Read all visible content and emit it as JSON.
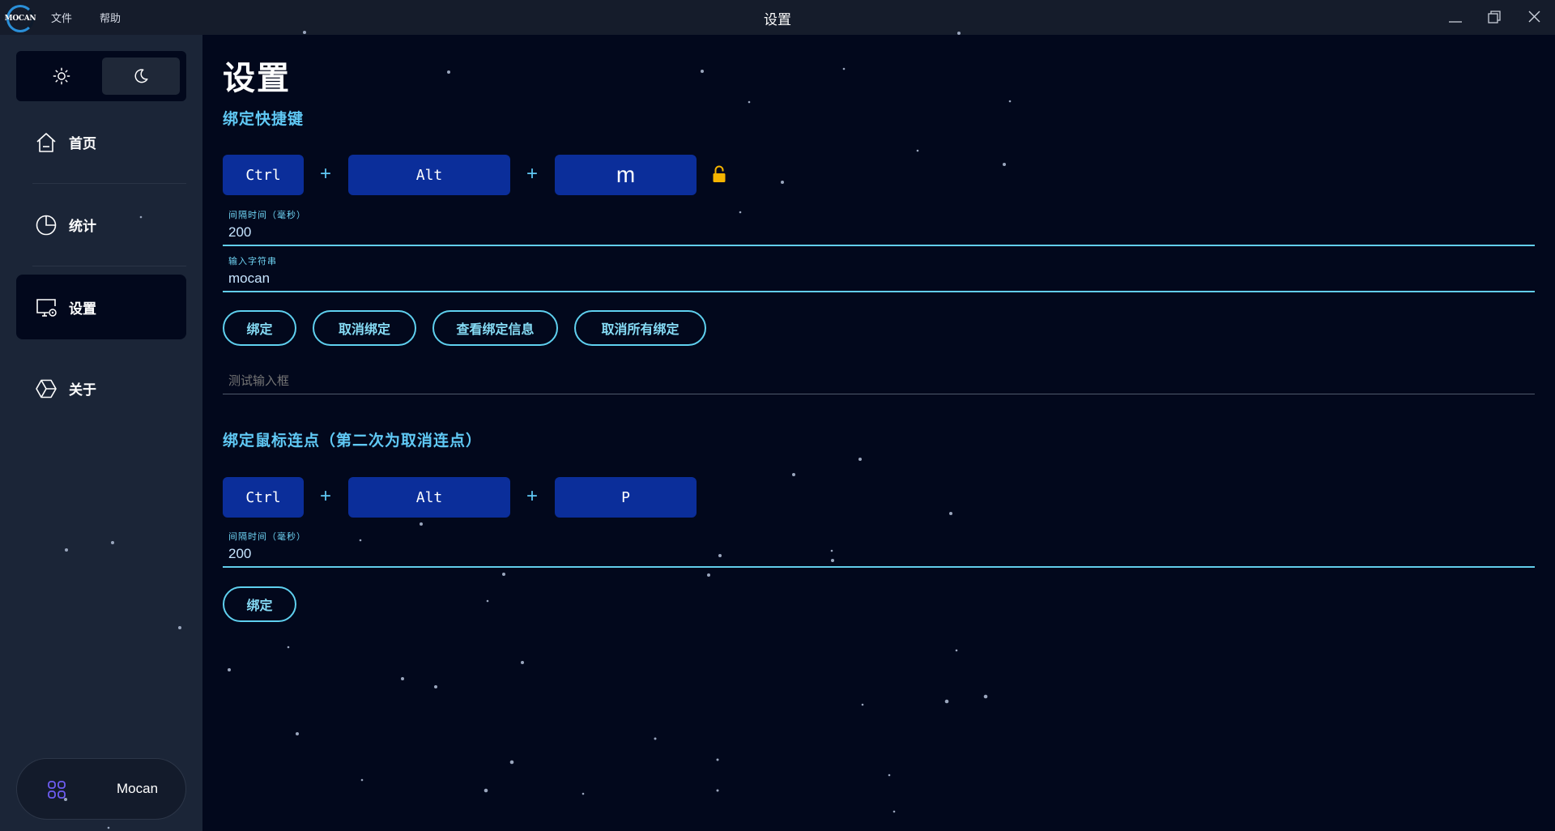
{
  "app": {
    "logo_text": "MOCAN",
    "window_title": "设置",
    "menu": [
      "文件",
      "帮助"
    ]
  },
  "icons": {
    "theme_light": "sun-icon",
    "theme_dark": "moon-icon",
    "lock": "lock-icon",
    "user": "grid-icon"
  },
  "sidebar": {
    "theme": {
      "active": "dark"
    },
    "items": [
      {
        "label": "首页",
        "icon": "home-icon",
        "active": false
      },
      {
        "label": "统计",
        "icon": "pie-chart-icon",
        "active": false
      },
      {
        "label": "设置",
        "icon": "monitor-settings-icon",
        "active": true
      },
      {
        "label": "关于",
        "icon": "cube-icon",
        "active": false
      }
    ],
    "user_name": "Mocan"
  },
  "page": {
    "title": "设置",
    "hotkey_section": {
      "title": "绑定快捷键",
      "keys": [
        "Ctrl",
        "Alt",
        "m"
      ],
      "plus": "+",
      "interval_label": "间隔时间（毫秒）",
      "interval_value": "200",
      "string_label": "输入字符串",
      "string_value": "mocan",
      "buttons": [
        "绑定",
        "取消绑定",
        "查看绑定信息",
        "取消所有绑定"
      ],
      "test_placeholder": "测试输入框"
    },
    "mouse_section": {
      "title": "绑定鼠标连点（第二次为取消连点）",
      "keys": [
        "Ctrl",
        "Alt",
        "P"
      ],
      "plus": "+",
      "interval_label": "间隔时间（毫秒）",
      "interval_value": "200",
      "button": "绑定"
    }
  },
  "colors": {
    "background": "#02081c",
    "sidebar": "#1b2537",
    "titlebar": "#151c2b",
    "key_button": "#0b2e9a",
    "accent": "#60c9f5",
    "lock": "#f5b400"
  }
}
